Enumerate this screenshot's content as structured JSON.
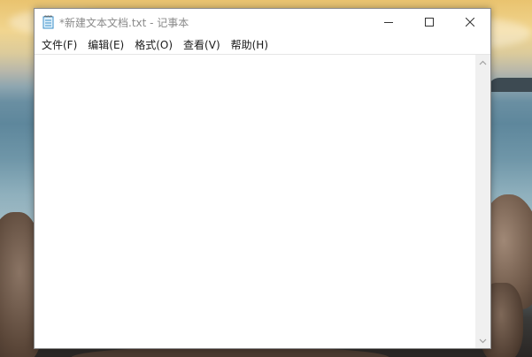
{
  "window": {
    "title": "*新建文本文档.txt - 记事本"
  },
  "menu": {
    "items": [
      {
        "id": "file",
        "label": "文件(F)"
      },
      {
        "id": "edit",
        "label": "编辑(E)"
      },
      {
        "id": "format",
        "label": "格式(O)"
      },
      {
        "id": "view",
        "label": "查看(V)"
      },
      {
        "id": "help",
        "label": "帮助(H)"
      }
    ]
  },
  "editor": {
    "content": ""
  },
  "icons": {
    "app": "notepad-icon",
    "minimize": "minimize-icon",
    "maximize": "maximize-icon",
    "close": "close-icon",
    "scroll_up": "chevron-up-icon",
    "scroll_down": "chevron-down-icon"
  },
  "colors": {
    "title_text": "#8a8a8a",
    "menu_text": "#1a1a1a",
    "scrollbar_track": "#f0f0f0"
  }
}
